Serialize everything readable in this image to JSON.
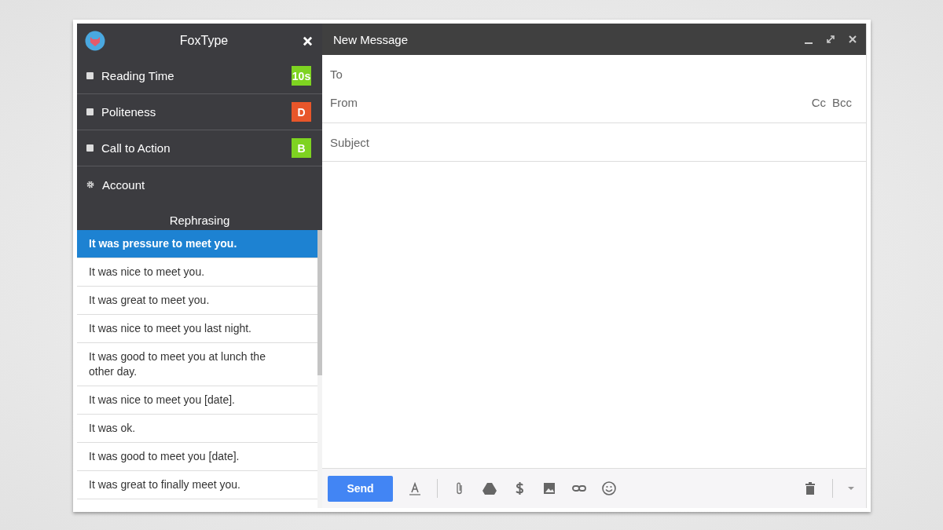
{
  "sidebar": {
    "title": "FoxType",
    "metrics": [
      {
        "label": "Reading Time",
        "grade": "10s",
        "color": "#7ed321"
      },
      {
        "label": "Politeness",
        "grade": "D",
        "color": "#e8562a"
      },
      {
        "label": "Call to Action",
        "grade": "B",
        "color": "#7ed321"
      }
    ],
    "account": "Account",
    "section_title": "Rephrasing",
    "rephrasings": [
      {
        "text": "It was pressure to meet you.",
        "selected": true
      },
      {
        "text": "It was nice to meet you.",
        "selected": false
      },
      {
        "text": "It was great to meet you.",
        "selected": false
      },
      {
        "text": "It was nice to meet you last night.",
        "selected": false
      },
      {
        "text": "It was good to meet you at lunch the other day.",
        "selected": false
      },
      {
        "text": "It was nice to meet you [date].",
        "selected": false
      },
      {
        "text": "It was ok.",
        "selected": false
      },
      {
        "text": "It was good to meet you [date].",
        "selected": false
      },
      {
        "text": "It was great to finally meet you.",
        "selected": false
      }
    ]
  },
  "compose": {
    "title": "New Message",
    "to_label": "To",
    "from_label": "From",
    "cc": "Cc",
    "bcc": "Bcc",
    "subject_placeholder": "Subject",
    "send": "Send"
  }
}
